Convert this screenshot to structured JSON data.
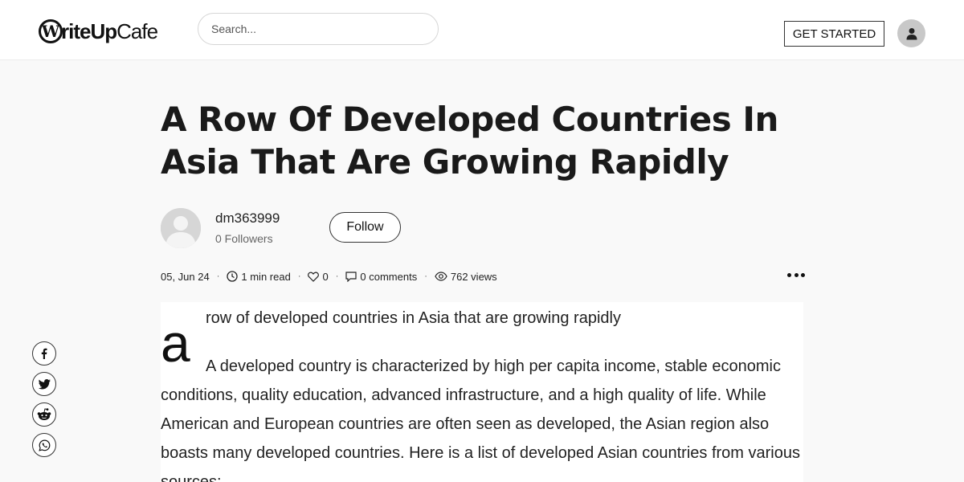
{
  "header": {
    "logo": {
      "bold": "riteUp",
      "light": "Cafe",
      "mark": "W"
    },
    "search": {
      "placeholder": "Search...",
      "value": ""
    },
    "get_started_label": "GET STARTED",
    "account_icon": "user-icon"
  },
  "article": {
    "title": "A Row Of Developed Countries In Asia That Are Growing Rapidly",
    "author": {
      "name": "dm363999",
      "followers": "0 Followers",
      "follow_label": "Follow",
      "avatar_icon": "default-avatar-icon"
    },
    "meta": {
      "date": "05, Jun 24",
      "read_time": "1 min read",
      "likes": "0",
      "comments": "0 comments",
      "views": "762 views"
    },
    "body": {
      "dropcap": "a",
      "first_line": "row of developed countries in Asia that are growing rapidly",
      "paragraph": "A developed country is characterized by high per capita income, stable economic conditions, quality education, advanced infrastructure, and a high quality of life. While American and European countries are often seen as developed, the Asian region also boasts many developed countries. Here is a list of developed Asian countries from various sources:"
    }
  },
  "share": {
    "icons": [
      "facebook-icon",
      "twitter-icon",
      "reddit-icon",
      "whatsapp-icon"
    ]
  },
  "colors": {
    "background": "#f9f9f9",
    "header_bg": "#ffffff",
    "text": "#222222",
    "avatar_gray": "#c8c8c8"
  }
}
